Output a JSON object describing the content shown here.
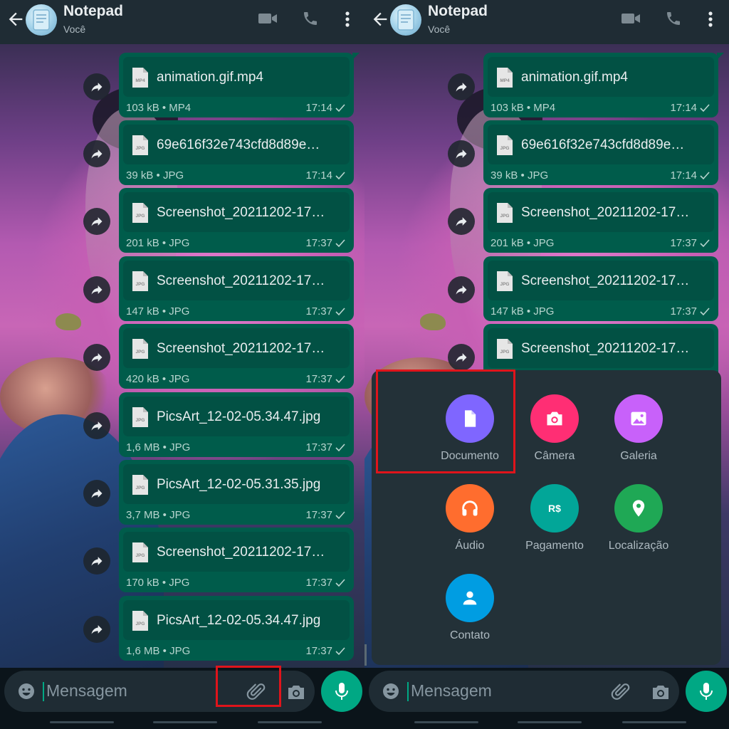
{
  "header": {
    "title": "Notepad",
    "subtitle": "Você"
  },
  "messages": [
    {
      "type_badge": "MP4",
      "name": "animation.gif.mp4",
      "meta": "103 kB • MP4",
      "time": "17:14"
    },
    {
      "type_badge": "JPG",
      "name": "69e616f32e743cfd8d89e…",
      "meta": "39 kB • JPG",
      "time": "17:14"
    },
    {
      "type_badge": "JPG",
      "name": "Screenshot_20211202-17…",
      "meta": "201 kB • JPG",
      "time": "17:37"
    },
    {
      "type_badge": "JPG",
      "name": "Screenshot_20211202-17…",
      "meta": "147 kB • JPG",
      "time": "17:37"
    },
    {
      "type_badge": "JPG",
      "name": "Screenshot_20211202-17…",
      "meta": "420 kB • JPG",
      "time": "17:37"
    },
    {
      "type_badge": "JPG",
      "name": "PicsArt_12-02-05.34.47.jpg",
      "meta": "1,6 MB • JPG",
      "time": "17:37"
    },
    {
      "type_badge": "JPG",
      "name": "PicsArt_12-02-05.31.35.jpg",
      "meta": "3,7 MB • JPG",
      "time": "17:37"
    },
    {
      "type_badge": "JPG",
      "name": "Screenshot_20211202-17…",
      "meta": "170 kB • JPG",
      "time": "17:37"
    },
    {
      "type_badge": "JPG",
      "name": "PicsArt_12-02-05.34.47.jpg",
      "meta": "1,6 MB • JPG",
      "time": "17:37"
    }
  ],
  "input": {
    "placeholder": "Mensagem"
  },
  "attach_menu": [
    {
      "label": "Documento",
      "color": "#7f66ff",
      "icon": "document-icon"
    },
    {
      "label": "Câmera",
      "color": "#ff2e74",
      "icon": "camera-icon"
    },
    {
      "label": "Galeria",
      "color": "#c861fa",
      "icon": "gallery-icon"
    },
    {
      "label": "Áudio",
      "color": "#ff6d2e",
      "icon": "headphones-icon"
    },
    {
      "label": "Pagamento",
      "color": "#02a698",
      "icon": "payment-icon"
    },
    {
      "label": "Localização",
      "color": "#1fa855",
      "icon": "location-icon"
    },
    {
      "label": "Contato",
      "color": "#009de2",
      "icon": "contact-icon"
    }
  ],
  "colors": {
    "accent": "#00a884",
    "bubble": "#005c4b",
    "highlight": "#e0141b"
  }
}
